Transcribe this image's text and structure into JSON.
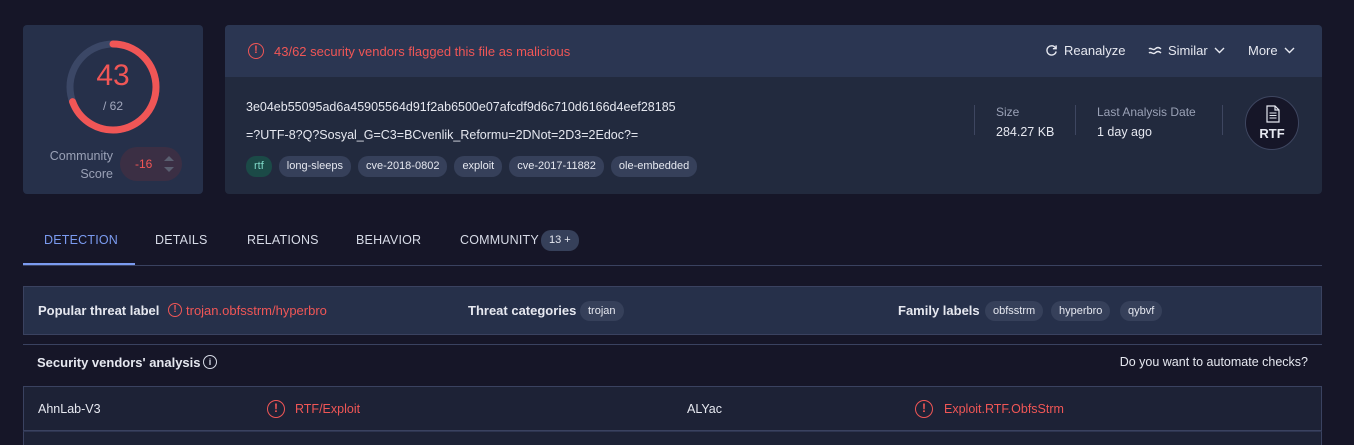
{
  "score": {
    "detections": "43",
    "total": "/ 62",
    "detection_ratio": 0.6935,
    "community_label_line1": "Community",
    "community_label_line2": "Score",
    "community_value": "-16"
  },
  "alert": {
    "text": "43/62 security vendors flagged this file as malicious",
    "color": "#f05656"
  },
  "actions": {
    "reanalyze": "Reanalyze",
    "similar": "Similar",
    "more": "More"
  },
  "file": {
    "hash": "3e04eb55095ad6a45905564d91f2ab6500e07afcdf9d6c710d6166d4eef28185",
    "name": "=?UTF-8?Q?Sosyal_G=C3=BCvenlik_Reformu=2DNot=2D3=2Edoc?=",
    "tags": [
      "rtf",
      "long-sleeps",
      "cve-2018-0802",
      "exploit",
      "cve-2017-11882",
      "ole-embedded"
    ],
    "size_label": "Size",
    "size_value": "284.27 KB",
    "date_label": "Last Analysis Date",
    "date_value": "1 day ago",
    "type_badge": "RTF"
  },
  "tabs": {
    "detection": "DETECTION",
    "details": "DETAILS",
    "relations": "RELATIONS",
    "behavior": "BEHAVIOR",
    "community": "COMMUNITY",
    "community_badge": "13 +"
  },
  "threat": {
    "popular_label": "Popular threat label",
    "popular_value": "trojan.obfsstrm/hyperbro",
    "categories_label": "Threat categories",
    "categories": [
      "trojan"
    ],
    "family_label": "Family labels",
    "families": [
      "obfsstrm",
      "hyperbro",
      "qybvf"
    ]
  },
  "vendors": {
    "title": "Security vendors' analysis",
    "automate": "Do you want to automate checks?",
    "rows": [
      {
        "left_name": "AhnLab-V3",
        "left_result": "RTF/Exploit",
        "right_name": "ALYac",
        "right_result": "Exploit.RTF.ObfsStrm"
      }
    ]
  },
  "colors": {
    "accent": "#7b9bf0",
    "danger": "#f05656",
    "background": "#161628",
    "card": "#222a3e"
  }
}
